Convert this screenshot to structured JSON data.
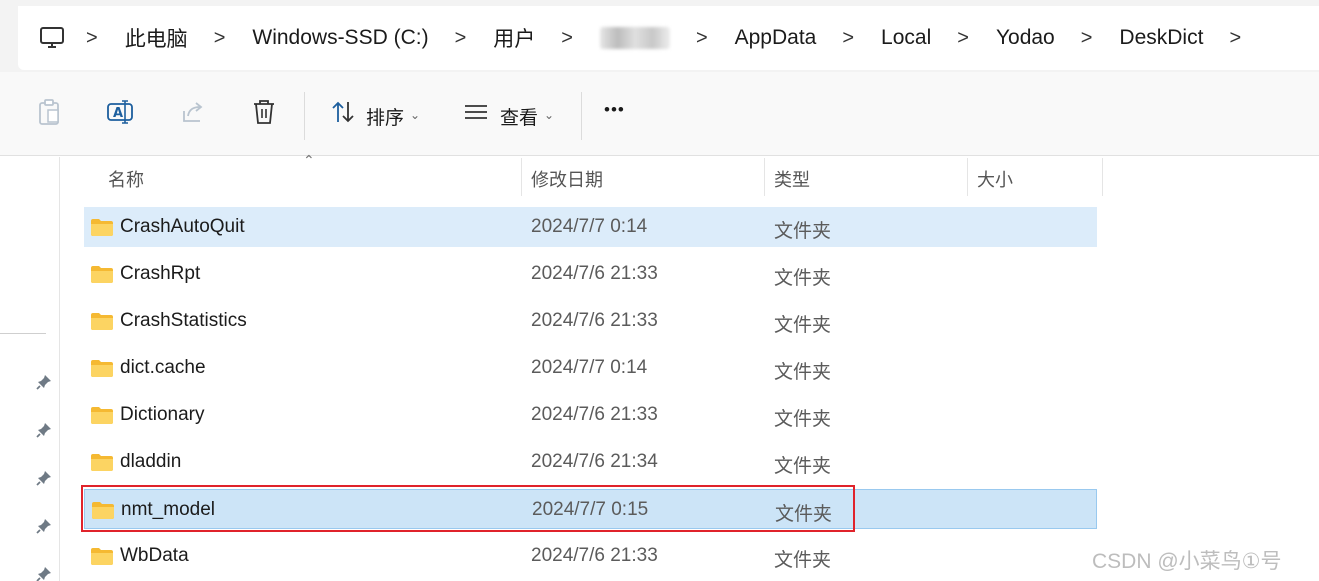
{
  "address_bar": {
    "crumbs": [
      "此电脑",
      "Windows-SSD (C:)",
      "用户",
      "",
      "AppData",
      "Local",
      "Yodao",
      "DeskDict"
    ],
    "separator": ">"
  },
  "toolbar": {
    "sort_label": "排序",
    "view_label": "查看",
    "more_label": "•••",
    "caret": "⌄"
  },
  "columns": {
    "name": "名称",
    "modified": "修改日期",
    "type": "类型",
    "size": "大小"
  },
  "rows": [
    {
      "name": "CrashAutoQuit",
      "modified": "2024/7/7 0:14",
      "type": "文件夹"
    },
    {
      "name": "CrashRpt",
      "modified": "2024/7/6 21:33",
      "type": "文件夹"
    },
    {
      "name": "CrashStatistics",
      "modified": "2024/7/6 21:33",
      "type": "文件夹"
    },
    {
      "name": "dict.cache",
      "modified": "2024/7/7 0:14",
      "type": "文件夹"
    },
    {
      "name": "Dictionary",
      "modified": "2024/7/6 21:33",
      "type": "文件夹"
    },
    {
      "name": "dladdin",
      "modified": "2024/7/6 21:34",
      "type": "文件夹"
    },
    {
      "name": "nmt_model",
      "modified": "2024/7/7 0:15",
      "type": "文件夹"
    },
    {
      "name": "WbData",
      "modified": "2024/7/6 21:33",
      "type": "文件夹"
    }
  ],
  "watermark": "CSDN @小菜鸟①号",
  "colors": {
    "selection": "#cce4f7",
    "hover": "#dcecfa",
    "highlight_box": "#e0232b",
    "folder": "#f8c94a"
  }
}
